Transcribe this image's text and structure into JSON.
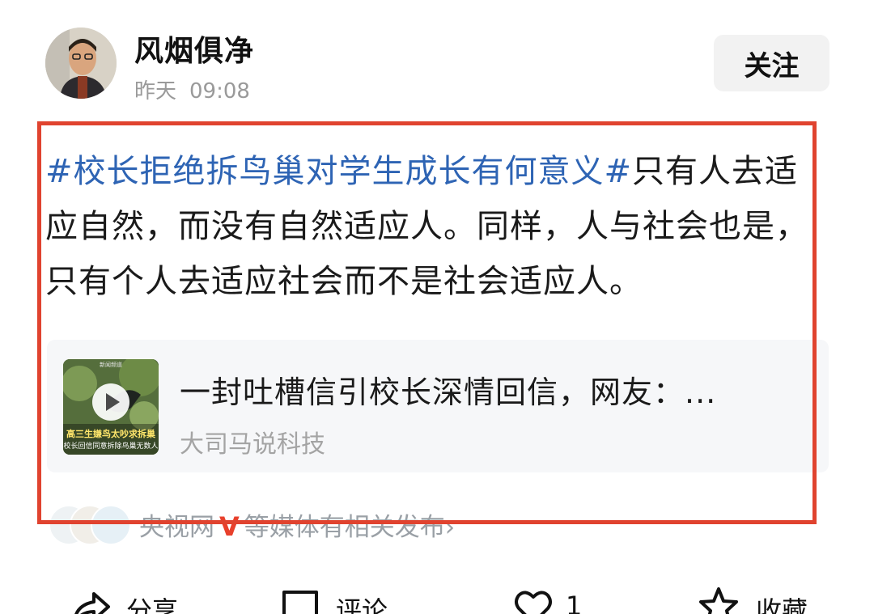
{
  "author": {
    "name": "风烟俱净",
    "time_day": "昨天",
    "time_clock": "09:08",
    "follow_label": "关注"
  },
  "post": {
    "hashtag": "#校长拒绝拆鸟巢对学生成长有何意义#",
    "body": "只有人去适应自然，而没有自然适应人。同样，人与社会也是，只有个人去适应社会而不是社会适应人。"
  },
  "link_card": {
    "title": "一封吐槽信引校长深情回信，网友：...",
    "source": "大司马说科技",
    "thumb_top": "新闻频道",
    "thumb_caption_1": "高三生嫌鸟太吵求拆巢",
    "thumb_caption_2": "校长回信同意拆除鸟巢无数人",
    "icon": "play-icon"
  },
  "media": {
    "source_name": "央视网",
    "suffix": "等媒体有相关发布",
    "chevron": "›",
    "verified_mark": "V"
  },
  "actions": {
    "share_label": "分享",
    "comment_label": "评论",
    "like_count": "1",
    "collect_label": "收藏"
  },
  "colors": {
    "hashtag": "#2e64b4",
    "highlight_border": "#e0432f",
    "verified": "#e8402c",
    "muted_text": "#9a9a9a"
  }
}
